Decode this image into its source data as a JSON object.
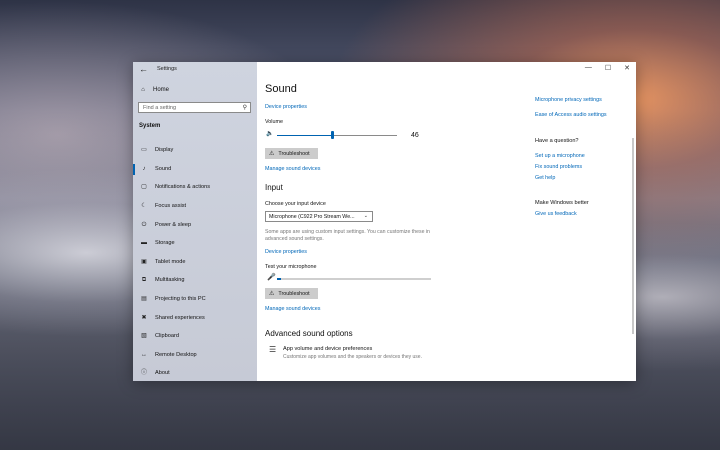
{
  "window": {
    "title": "Settings",
    "controls": {
      "minimize": "—",
      "maximize": "☐",
      "close": "✕"
    }
  },
  "sidebar": {
    "home_label": "Home",
    "search_placeholder": "Find a setting",
    "section": "System",
    "items": [
      {
        "label": "Display",
        "icon": "display-icon",
        "glyph": "▭"
      },
      {
        "label": "Sound",
        "icon": "sound-icon",
        "glyph": "♪",
        "active": true
      },
      {
        "label": "Notifications & actions",
        "icon": "notifications-icon",
        "glyph": "▢"
      },
      {
        "label": "Focus assist",
        "icon": "focus-assist-icon",
        "glyph": "☾"
      },
      {
        "label": "Power & sleep",
        "icon": "power-icon",
        "glyph": "⏻"
      },
      {
        "label": "Storage",
        "icon": "storage-icon",
        "glyph": "▬"
      },
      {
        "label": "Tablet mode",
        "icon": "tablet-mode-icon",
        "glyph": "▣"
      },
      {
        "label": "Multitasking",
        "icon": "multitasking-icon",
        "glyph": "⧉"
      },
      {
        "label": "Projecting to this PC",
        "icon": "projecting-icon",
        "glyph": "▤"
      },
      {
        "label": "Shared experiences",
        "icon": "shared-experiences-icon",
        "glyph": "✖"
      },
      {
        "label": "Clipboard",
        "icon": "clipboard-icon",
        "glyph": "▧"
      },
      {
        "label": "Remote Desktop",
        "icon": "remote-desktop-icon",
        "glyph": "↔"
      },
      {
        "label": "About",
        "icon": "about-icon",
        "glyph": "ⓘ"
      }
    ]
  },
  "main": {
    "title": "Sound",
    "output": {
      "device_properties": "Device properties",
      "volume_label": "Volume",
      "volume_value": "46",
      "troubleshoot": "Troubleshoot",
      "manage_devices": "Manage sound devices"
    },
    "input": {
      "heading": "Input",
      "choose_label": "Choose your input device",
      "selected_device": "Microphone (C922 Pro Stream We...",
      "note": "Some apps are using custom input settings. You can customize these in advanced sound settings.",
      "device_properties": "Device properties",
      "test_label": "Test your microphone",
      "troubleshoot": "Troubleshoot",
      "manage_devices": "Manage sound devices"
    },
    "advanced": {
      "heading": "Advanced sound options",
      "app_volume_title": "App volume and device preferences",
      "app_volume_desc": "Customize app volumes and the speakers or devices they use."
    }
  },
  "related": {
    "links": [
      "Microphone privacy settings",
      "Ease of Access audio settings"
    ],
    "question_title": "Have a question?",
    "question_links": [
      "Set up a microphone",
      "Fix sound problems",
      "Get help"
    ],
    "better_title": "Make Windows better",
    "feedback_link": "Give us feedback"
  },
  "colors": {
    "accent": "#0063b1",
    "link": "#0067b8"
  }
}
